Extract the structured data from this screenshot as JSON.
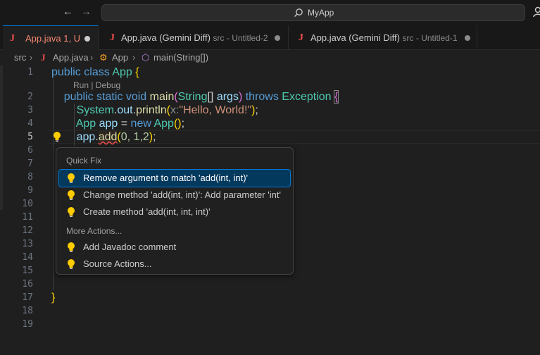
{
  "titlebar": {
    "back_icon": "arrow-left-icon",
    "forward_icon": "arrow-right-icon",
    "command_center_title": "MyApp",
    "search_icon": "search-icon",
    "account_icon": "account-icon"
  },
  "tabs": [
    {
      "file_icon": "J",
      "name": "App.java",
      "description": "",
      "status": "1, U",
      "modified_dot": true,
      "active": true
    },
    {
      "file_icon": "J",
      "name": "App.java (Gemini Diff)",
      "description": "src - Untitled-2",
      "modified_dot": true,
      "active": false
    },
    {
      "file_icon": "J",
      "name": "App.java (Gemini Diff)",
      "description": "src - Untitled-1",
      "modified_dot": true,
      "active": false
    }
  ],
  "breadcrumb": {
    "folder": "src",
    "file_icon": "J",
    "file": "App.java",
    "class_icon": "class-icon",
    "class": "App",
    "method_icon": "method-cube-icon",
    "method": "main(String[])"
  },
  "codelens": "Run | Debug",
  "line_numbers": [
    "1",
    "2",
    "3",
    "4",
    "5",
    "6",
    "7",
    "8",
    "9",
    "10",
    "11",
    "12",
    "13",
    "14",
    "15",
    "16",
    "17",
    "18",
    "19"
  ],
  "current_line": "5",
  "code": {
    "l1": {
      "public": "public",
      "class": "class",
      "name": "App",
      "brace": "{"
    },
    "l2": {
      "public": "public",
      "static": "static",
      "void": "void",
      "main": "main",
      "string": "String",
      "brackets": "[]",
      "args": "args",
      "throws": "throws",
      "exception": "Exception",
      "brace": "{"
    },
    "l3": {
      "system": "System",
      "out": "out",
      "println": "println",
      "hint": "x:",
      "text": "\"Hello, World!\""
    },
    "l4": {
      "app_type": "App",
      "app_var": "app",
      "new": "new",
      "ctor": "App"
    },
    "l5": {
      "app_var": "app",
      "method": "add",
      "args": "0, 1,2"
    },
    "l17": {
      "brace": "}"
    }
  },
  "quick_fix": {
    "header": "Quick Fix",
    "items": [
      {
        "label": "Remove argument to match 'add(int, int)'",
        "selected": true,
        "icon": "lightbulb-icon"
      },
      {
        "label": "Change method 'add(int, int)': Add parameter 'int'",
        "selected": false,
        "icon": "lightbulb-icon"
      },
      {
        "label": "Create method 'add(int, int, int)'",
        "selected": false,
        "icon": "lightbulb-icon"
      }
    ],
    "more_header": "More Actions...",
    "more_items": [
      {
        "label": "Add Javadoc comment",
        "icon": "lightbulb-icon"
      },
      {
        "label": "Source Actions...",
        "icon": "lightbulb-icon"
      }
    ]
  },
  "colors": {
    "accent": "#0078d4",
    "error": "#f14c4c",
    "lightbulb": "#ffcc00",
    "selected_item": "#04395e"
  }
}
